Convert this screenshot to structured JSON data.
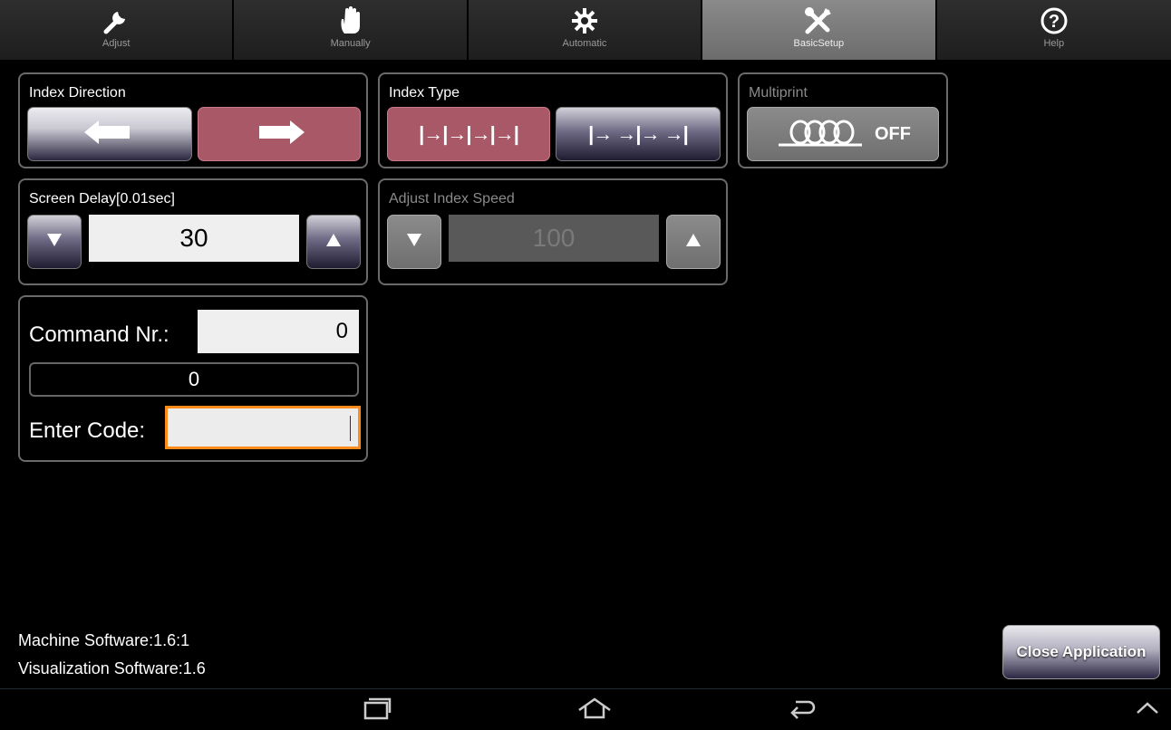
{
  "tabs": [
    {
      "label": "Adjust",
      "icon": "wrench-icon"
    },
    {
      "label": "Manually",
      "icon": "hand-icon"
    },
    {
      "label": "Automatic",
      "icon": "gear-icon"
    },
    {
      "label": "BasicSetup",
      "icon": "tools-icon",
      "active": true
    },
    {
      "label": "Help",
      "icon": "help-icon"
    }
  ],
  "index_direction": {
    "title": "Index Direction",
    "selected": "right"
  },
  "index_type": {
    "title": "Index Type",
    "option_a": "|→|→|→|→|",
    "option_b": "|→ →|→ →|",
    "selected": "a"
  },
  "multiprint": {
    "title": "Multiprint",
    "state": "OFF"
  },
  "screen_delay": {
    "title": "Screen Delay[0.01sec]",
    "value": "30"
  },
  "adjust_index_speed": {
    "title": "Adjust Index Speed",
    "value": "100"
  },
  "command": {
    "label": "Command Nr.:",
    "value": "0",
    "result": "0",
    "code_label": "Enter Code:",
    "code_value": ""
  },
  "software": {
    "machine": "Machine Software:1.6:1",
    "visualization": "Visualization Software:1.6"
  },
  "close_button": "Close Application",
  "colors": {
    "selected": "#a85866",
    "active_tab": "#7a7a7a",
    "focus": "#ff8c1a"
  }
}
